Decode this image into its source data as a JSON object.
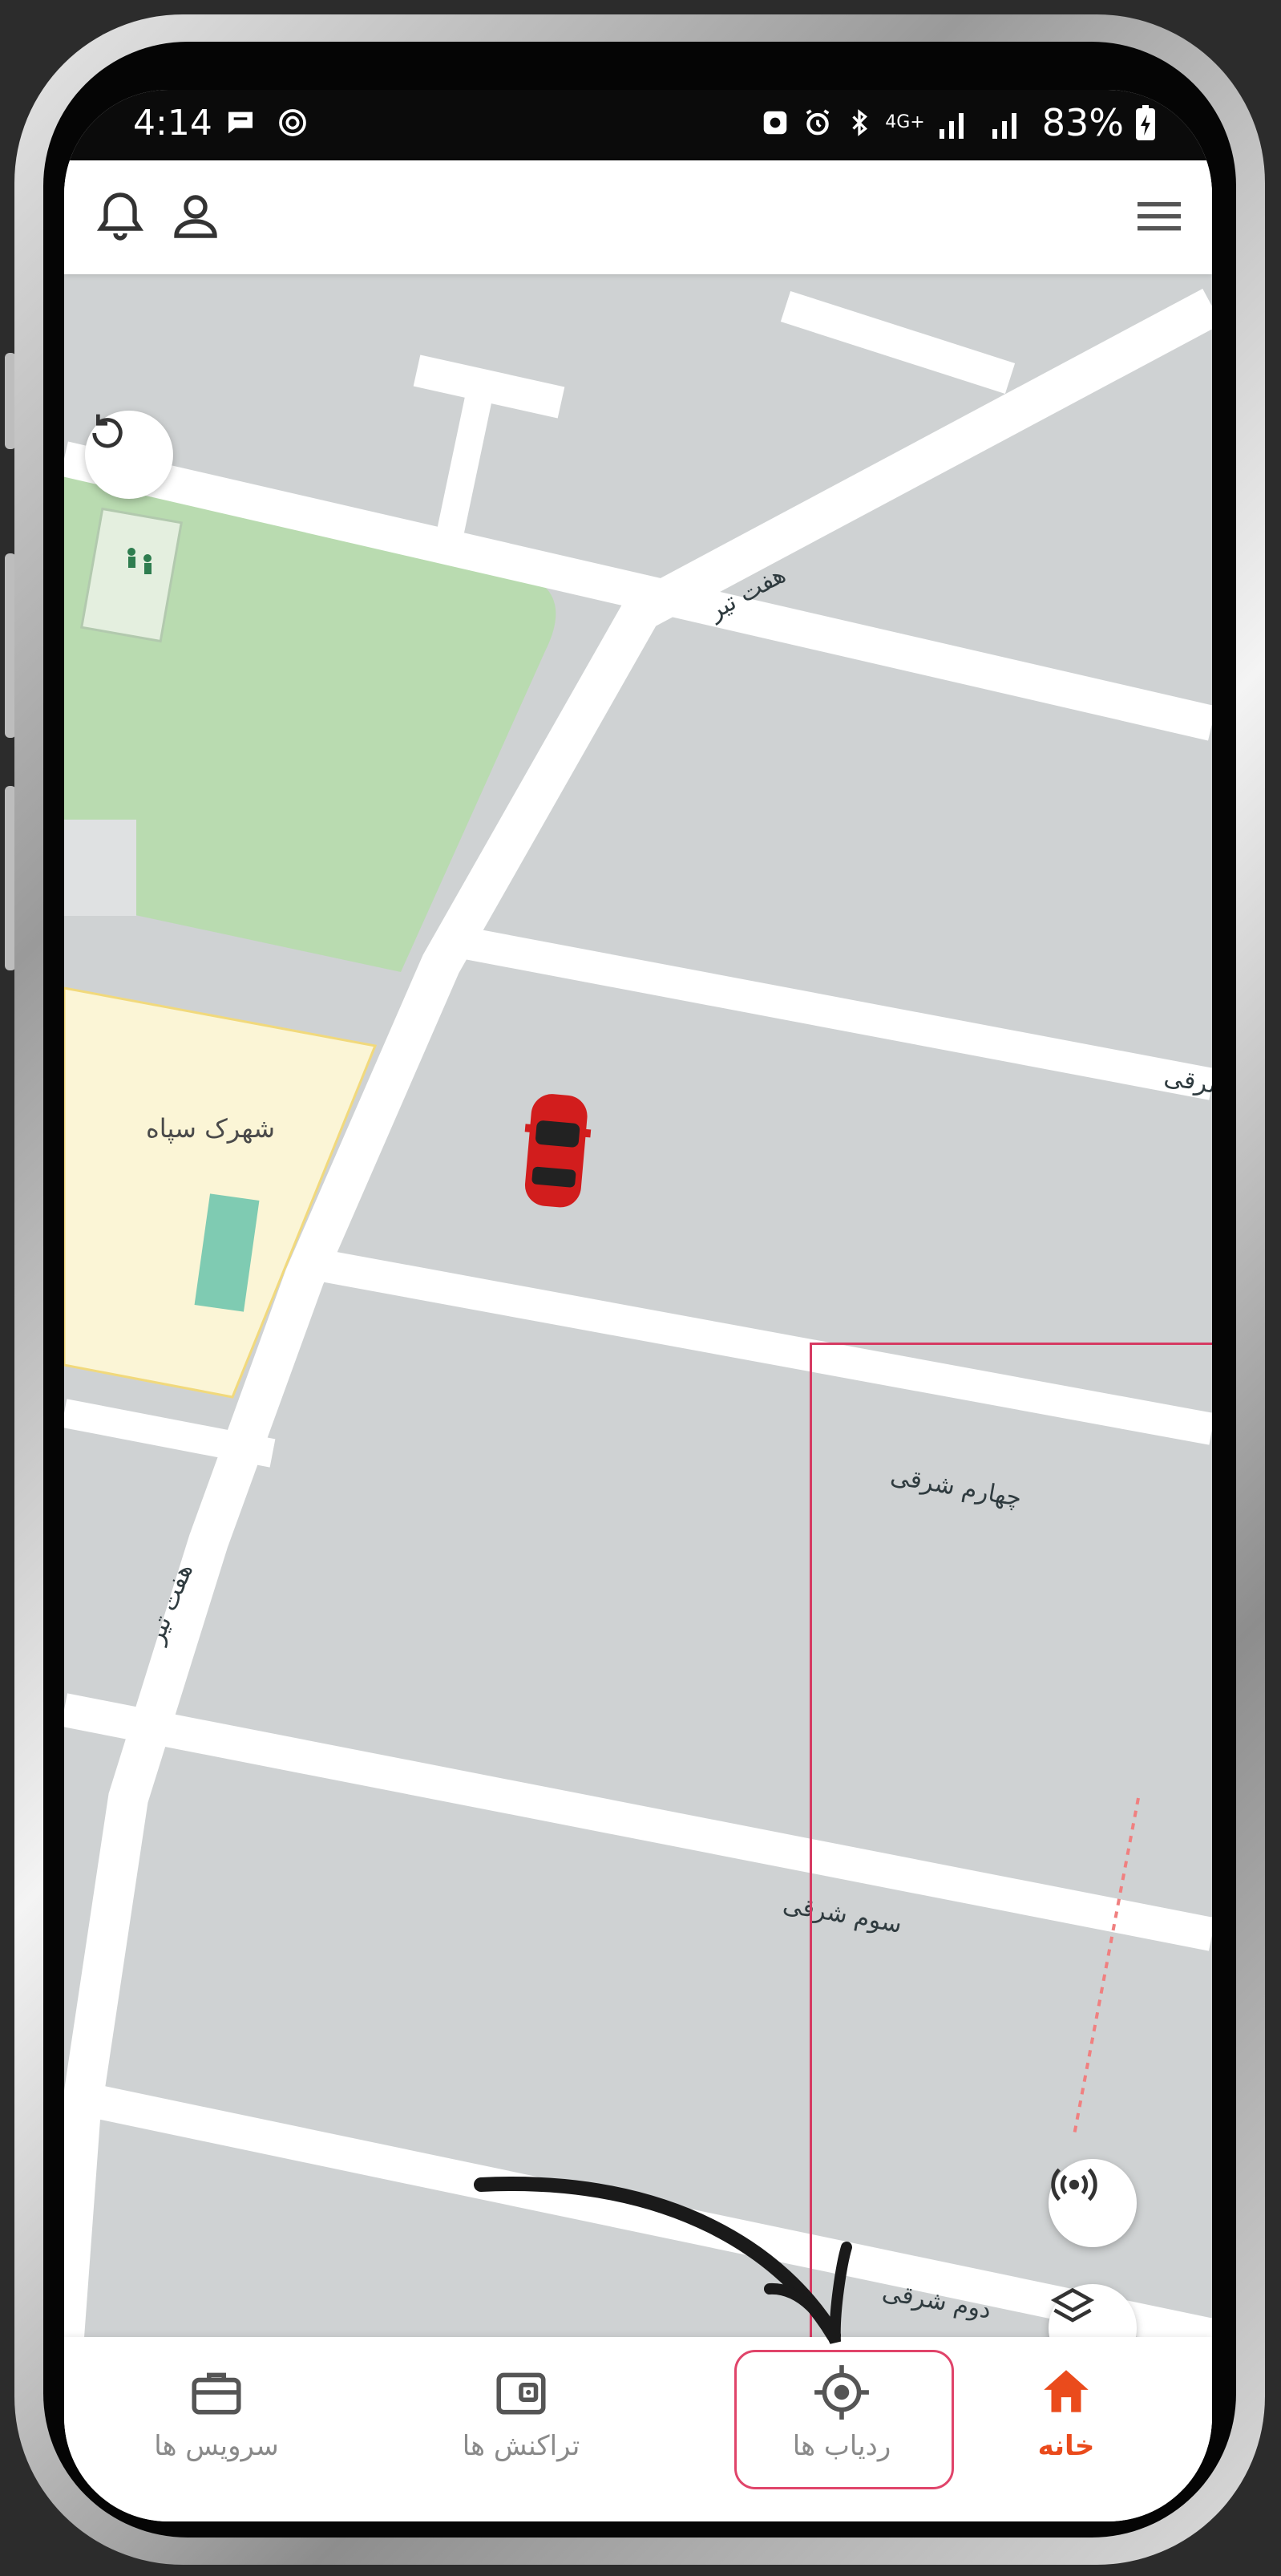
{
  "status_bar": {
    "time": "4:14",
    "network": "4G+",
    "battery": "83%"
  },
  "header": {
    "left_icons": [
      "bell-icon",
      "user-icon"
    ],
    "right_icon": "hamburger-menu-icon"
  },
  "map": {
    "area_label": "شهرک سپاه",
    "streets": {
      "haft_tir_top": "هفت تیر",
      "haft_tir_bottom": "هفت تیر",
      "partial_sharghi": "شرقی",
      "chaharom": "چهارم شرقی",
      "sevom": "سوم شرقی",
      "dovom_partial": "دوم شرقی"
    },
    "controls": [
      "refresh-icon",
      "broadcast-icon",
      "layers-icon"
    ],
    "vehicle": "red-car-icon"
  },
  "bottom_nav": {
    "items": [
      {
        "label": "سرویس ها",
        "icon": "briefcase-icon",
        "active": false
      },
      {
        "label": "تراکنش ها",
        "icon": "wallet-icon",
        "active": false
      },
      {
        "label": "ردیاب ها",
        "icon": "target-icon",
        "active": false
      },
      {
        "label": "خانه",
        "icon": "home-icon",
        "active": true
      }
    ]
  },
  "colors": {
    "accent": "#ea4b1c",
    "highlight": "#e0446a",
    "map_base": "#cfd2d3",
    "park": "#b9dbb0",
    "residential": "#fbf5d6"
  }
}
